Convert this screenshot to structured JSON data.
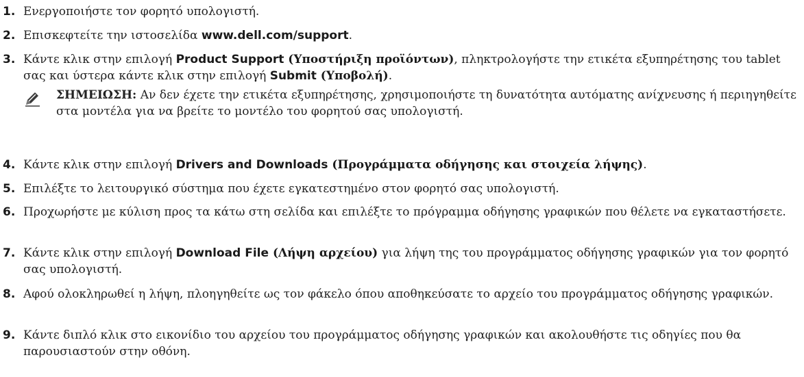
{
  "steps": [
    {
      "num": "1.",
      "before": "Ενεργοποιήστε τον φορητό υπολογιστή.",
      "bold_sans": "",
      "bold_serif": "",
      "middle": "",
      "bold_sans2": "",
      "bold_serif2": "",
      "after": ""
    },
    {
      "num": "2.",
      "before": "Επισκεφτείτε την ιστοσελίδα ",
      "bold_sans": "www.dell.com/support",
      "bold_serif": "",
      "middle": "",
      "bold_sans2": "",
      "bold_serif2": "",
      "after": "."
    },
    {
      "num": "3.",
      "before": "Κάντε κλικ στην επιλογή ",
      "bold_sans": "Product Support",
      "bold_serif": " (Υποστήριξη προϊόντων)",
      "middle": ", πληκτρολογήστε την ετικέτα εξυπηρέτησης του tablet σας και ύστερα κάντε κλικ στην επιλογή ",
      "bold_sans2": "Submit",
      "bold_serif2": " (Υποβολή)",
      "after": "."
    },
    {
      "num": "4.",
      "before": "Κάντε κλικ στην επιλογή ",
      "bold_sans": "Drivers and Downloads",
      "bold_serif": " (Προγράμματα οδήγησης και στοιχεία λήψης)",
      "middle": "",
      "bold_sans2": "",
      "bold_serif2": "",
      "after": "."
    },
    {
      "num": "5.",
      "before": "Επιλέξτε το λειτουργικό σύστημα που έχετε εγκατεστημένο στον φορητό σας υπολογιστή.",
      "bold_sans": "",
      "bold_serif": "",
      "middle": "",
      "bold_sans2": "",
      "bold_serif2": "",
      "after": ""
    },
    {
      "num": "6.",
      "before": "Προχωρήστε με κύλιση προς τα κάτω στη σελίδα και επιλέξτε το πρόγραμμα οδήγησης γραφικών που θέλετε να εγκαταστήσετε.",
      "bold_sans": "",
      "bold_serif": "",
      "middle": "",
      "bold_sans2": "",
      "bold_serif2": "",
      "after": ""
    },
    {
      "num": "7.",
      "before": "Κάντε κλικ στην επιλογή ",
      "bold_sans": "Download File",
      "bold_serif": " (Λήψη αρχείου)",
      "middle": "",
      "bold_sans2": "",
      "bold_serif2": "",
      "after": " για λήψη της του προγράμματος οδήγησης γραφικών για τον φορητό σας υπολογιστή."
    },
    {
      "num": "8.",
      "before": "Αφού ολοκληρωθεί η λήψη, πλοηγηθείτε ως τον φάκελο όπου αποθηκεύσατε το αρχείο του προγράμματος οδήγησης γραφικών.",
      "bold_sans": "",
      "bold_serif": "",
      "middle": "",
      "bold_sans2": "",
      "bold_serif2": "",
      "after": ""
    },
    {
      "num": "9.",
      "before": "Κάντε διπλό κλικ στο εικονίδιο του αρχείου του προγράμματος οδήγησης γραφικών και ακολουθήστε τις οδηγίες που θα παρουσιαστούν στην οθόνη.",
      "bold_sans": "",
      "bold_serif": "",
      "middle": "",
      "bold_sans2": "",
      "bold_serif2": "",
      "after": ""
    }
  ],
  "note": {
    "icon": "pencil-icon",
    "label": "ΣΗΜΕΙΩΣΗ:",
    "text": " Αν δεν έχετε την ετικέτα εξυπηρέτησης, χρησιμοποιήστε τη δυνατότητα αυτόματης ανίχνευσης ή περιηγηθείτε στα μοντέλα για να βρείτε το μοντέλο του φορητού σας υπολογιστή."
  }
}
